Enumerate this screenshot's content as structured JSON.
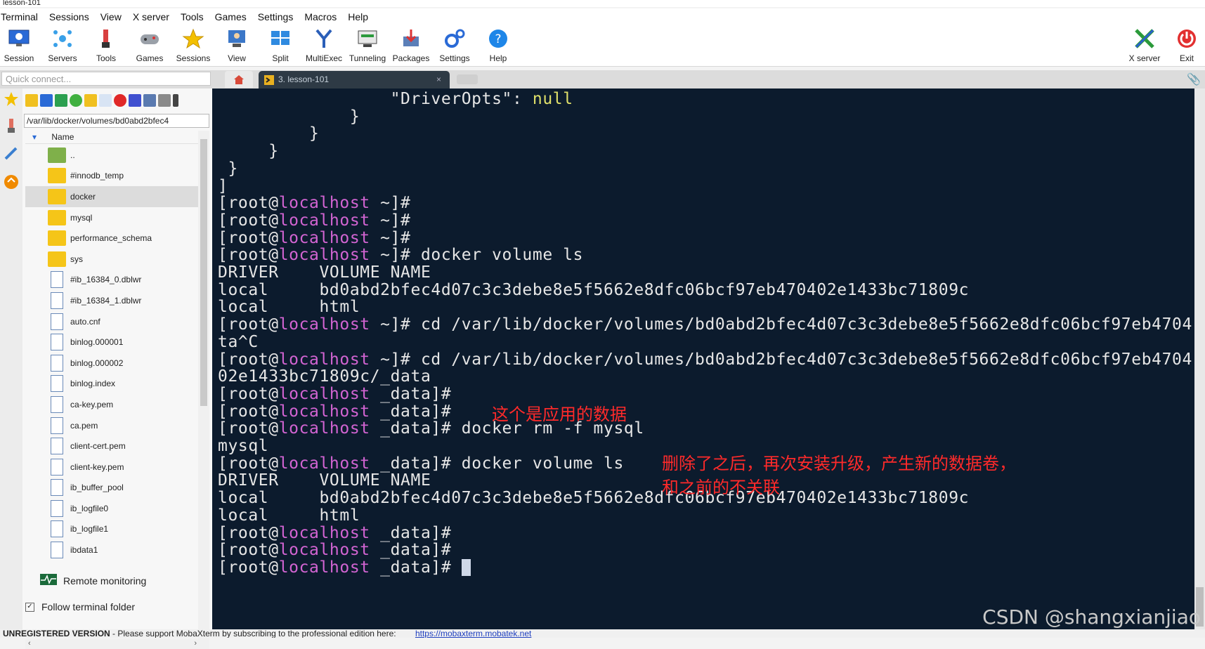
{
  "window": {
    "title": "lesson-101"
  },
  "menu": [
    "Terminal",
    "Sessions",
    "View",
    "X server",
    "Tools",
    "Games",
    "Settings",
    "Macros",
    "Help"
  ],
  "toolbar": {
    "session": "Session",
    "servers": "Servers",
    "tools": "Tools",
    "games": "Games",
    "sessions": "Sessions",
    "view": "View",
    "split": "Split",
    "multiexec": "MultiExec",
    "tunneling": "Tunneling",
    "packages": "Packages",
    "settings": "Settings",
    "help": "Help",
    "xserver": "X server",
    "exit": "Exit"
  },
  "tabs": {
    "quick_connect_placeholder": "Quick connect...",
    "active_tab": "3. lesson-101",
    "close": "×"
  },
  "sftp": {
    "path": "/var/lib/docker/volumes/bd0abd2bfec4",
    "column_name": "Name",
    "files": [
      {
        "name": "..",
        "type": "parent"
      },
      {
        "name": "#innodb_temp",
        "type": "folder"
      },
      {
        "name": "docker",
        "type": "folder",
        "selected": true
      },
      {
        "name": "mysql",
        "type": "folder"
      },
      {
        "name": "performance_schema",
        "type": "folder"
      },
      {
        "name": "sys",
        "type": "folder"
      },
      {
        "name": "#ib_16384_0.dblwr",
        "type": "file"
      },
      {
        "name": "#ib_16384_1.dblwr",
        "type": "file"
      },
      {
        "name": "auto.cnf",
        "type": "file"
      },
      {
        "name": "binlog.000001",
        "type": "file"
      },
      {
        "name": "binlog.000002",
        "type": "file"
      },
      {
        "name": "binlog.index",
        "type": "file"
      },
      {
        "name": "ca-key.pem",
        "type": "file"
      },
      {
        "name": "ca.pem",
        "type": "file"
      },
      {
        "name": "client-cert.pem",
        "type": "file"
      },
      {
        "name": "client-key.pem",
        "type": "file"
      },
      {
        "name": "ib_buffer_pool",
        "type": "file"
      },
      {
        "name": "ib_logfile0",
        "type": "file"
      },
      {
        "name": "ib_logfile1",
        "type": "file"
      },
      {
        "name": "ibdata1",
        "type": "file"
      }
    ],
    "remote_monitoring": "Remote monitoring",
    "follow_folder": "Follow terminal folder"
  },
  "terminal": {
    "lines": [
      {
        "indent": "                 ",
        "text": "\"DriverOpts\": ",
        "kw": "null"
      },
      {
        "text": "             }"
      },
      {
        "text": "         }"
      },
      {
        "text": "     }"
      },
      {
        "text": " }"
      },
      {
        "text": "]"
      },
      {
        "user": "[root@",
        "host": "localhost",
        "rest": " ~]#"
      },
      {
        "user": "[root@",
        "host": "localhost",
        "rest": " ~]#"
      },
      {
        "user": "[root@",
        "host": "localhost",
        "rest": " ~]#"
      },
      {
        "user": "[root@",
        "host": "localhost",
        "rest": " ~]# docker volume ls"
      },
      {
        "text": "DRIVER    VOLUME NAME"
      },
      {
        "text": "local     bd0abd2bfec4d07c3c3debe8e5f5662e8dfc06bcf97eb470402e1433bc71809c"
      },
      {
        "text": "local     html"
      },
      {
        "user": "[root@",
        "host": "localhost",
        "rest": " ~]# cd /var/lib/docker/volumes/bd0abd2bfec4d07c3c3debe8e5f5662e8dfc06bcf97eb4704"
      },
      {
        "text": "ta^C"
      },
      {
        "user": "[root@",
        "host": "localhost",
        "rest": " ~]# cd /var/lib/docker/volumes/bd0abd2bfec4d07c3c3debe8e5f5662e8dfc06bcf97eb4704"
      },
      {
        "text": "02e1433bc71809c/_data"
      },
      {
        "user": "[root@",
        "host": "localhost",
        "rest": " _data]#"
      },
      {
        "user": "[root@",
        "host": "localhost",
        "rest": " _data]#"
      },
      {
        "user": "[root@",
        "host": "localhost",
        "rest": " _data]# docker rm -f mysql"
      },
      {
        "text": "mysql"
      },
      {
        "user": "[root@",
        "host": "localhost",
        "rest": " _data]# docker volume ls"
      },
      {
        "text": "DRIVER    VOLUME NAME"
      },
      {
        "text": "local     bd0abd2bfec4d07c3c3debe8e5f5662e8dfc06bcf97eb470402e1433bc71809c"
      },
      {
        "text": "local     html"
      },
      {
        "user": "[root@",
        "host": "localhost",
        "rest": " _data]#"
      },
      {
        "user": "[root@",
        "host": "localhost",
        "rest": " _data]#"
      },
      {
        "user": "[root@",
        "host": "localhost",
        "rest": " _data]# ",
        "cursor": true
      }
    ]
  },
  "annotations": {
    "app_data": "这个是应用的数据",
    "reinstall_line1": "删除了之后，再次安装升级，产生新的数据卷，",
    "reinstall_line2": "和之前的不关联"
  },
  "status": {
    "unregistered": "UNREGISTERED VERSION",
    "support": "  -  Please support MobaXterm by subscribing to the professional edition here:",
    "link": "https://mobaxterm.mobatek.net"
  },
  "watermark": "CSDN @shangxianjiao",
  "colors": {
    "terminal_bg": "#0c1b2d",
    "host": "#d264d2",
    "annotation": "#ff2a2a"
  }
}
